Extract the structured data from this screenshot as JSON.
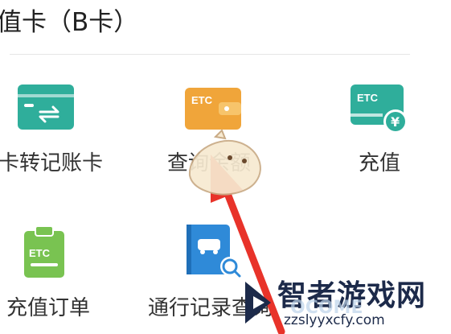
{
  "header": {
    "title": "值卡（B卡）"
  },
  "grid": [
    {
      "label": "卡转记账卡",
      "icon": "card-transfer-icon",
      "color": "#2fae9b"
    },
    {
      "label": "查询余额",
      "icon": "etc-wallet-icon",
      "color": "#f0a53a"
    },
    {
      "label": "充值",
      "icon": "etc-recharge-icon",
      "color": "#2fae9b"
    },
    {
      "label": "充值订单",
      "icon": "etc-order-icon",
      "color": "#79c351"
    },
    {
      "label": "通行记录查询",
      "icon": "trip-record-icon",
      "color": "#2f8ad8"
    }
  ],
  "icon_text": {
    "etc": "ETC"
  },
  "watermark": {
    "title": "智者游戏网",
    "url": "zzslyyxcfy.com",
    "overlay": "OCOME"
  },
  "colors": {
    "arrow": "#e8332a",
    "text": "#333333",
    "divider": "#e6e6e6"
  }
}
